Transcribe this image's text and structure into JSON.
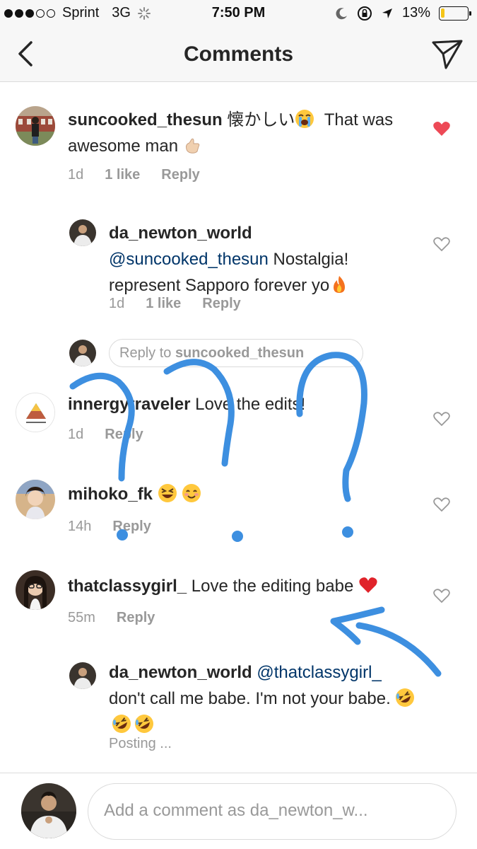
{
  "status_bar": {
    "carrier": "Sprint",
    "network": "3G",
    "time": "7:50 PM",
    "battery": "13%",
    "battery_level": 0.13,
    "icons": [
      "signal-dots-icon",
      "loading-spinner-icon",
      "moon-icon",
      "rotation-lock-icon",
      "location-arrow-icon",
      "battery-icon"
    ]
  },
  "header": {
    "title": "Comments",
    "back_icon": "chevron-left-icon",
    "share_icon": "paper-plane-icon"
  },
  "comments": [
    {
      "username": "suncooked_thesun",
      "text_before_emoji": "懐かしい",
      "text_after_emoji": "That was awesome man",
      "emojis": [
        "loudly-crying-face",
        "call-me-hand"
      ],
      "time": "1d",
      "likes": "1 like",
      "reply": "Reply",
      "liked": true,
      "like_color": "#ed4956"
    },
    {
      "username": "da_newton_world",
      "mention": "@suncooked_thesun",
      "text": "Nostalgia! represent Sapporo forever yo",
      "emojis": [
        "fire"
      ],
      "time": "1d",
      "likes": "1 like",
      "reply": "Reply",
      "liked": false
    },
    {
      "username": "innergytraveler",
      "text": "Love the edits!",
      "time": "1d",
      "reply": "Reply",
      "liked": false
    },
    {
      "username": "mihoko_fk",
      "emojis": [
        "grinning-squinting-face",
        "smiling-face-with-smiling-eyes"
      ],
      "time": "14h",
      "reply": "Reply",
      "liked": false
    },
    {
      "username": "thatclassygirl_",
      "text": "Love the editing babe",
      "emojis": [
        "red-heart"
      ],
      "time": "55m",
      "reply": "Reply",
      "liked": false
    },
    {
      "username": "da_newton_world",
      "mention": "@thatclassygirl_",
      "text": "don't call me babe. I'm not your babe.",
      "emojis": [
        "rolling-on-the-floor-laughing",
        "rolling-on-the-floor-laughing",
        "rolling-on-the-floor-laughing"
      ],
      "status": "Posting ..."
    }
  ],
  "reply_box": {
    "prefix": "Reply to",
    "to_user": "suncooked_thesun"
  },
  "composer": {
    "placeholder": "Add a comment as da_newton_w..."
  },
  "annotation": {
    "color": "#3d8fe0",
    "marks": [
      "question-mark",
      "question-mark",
      "question-mark",
      "arrow"
    ]
  }
}
